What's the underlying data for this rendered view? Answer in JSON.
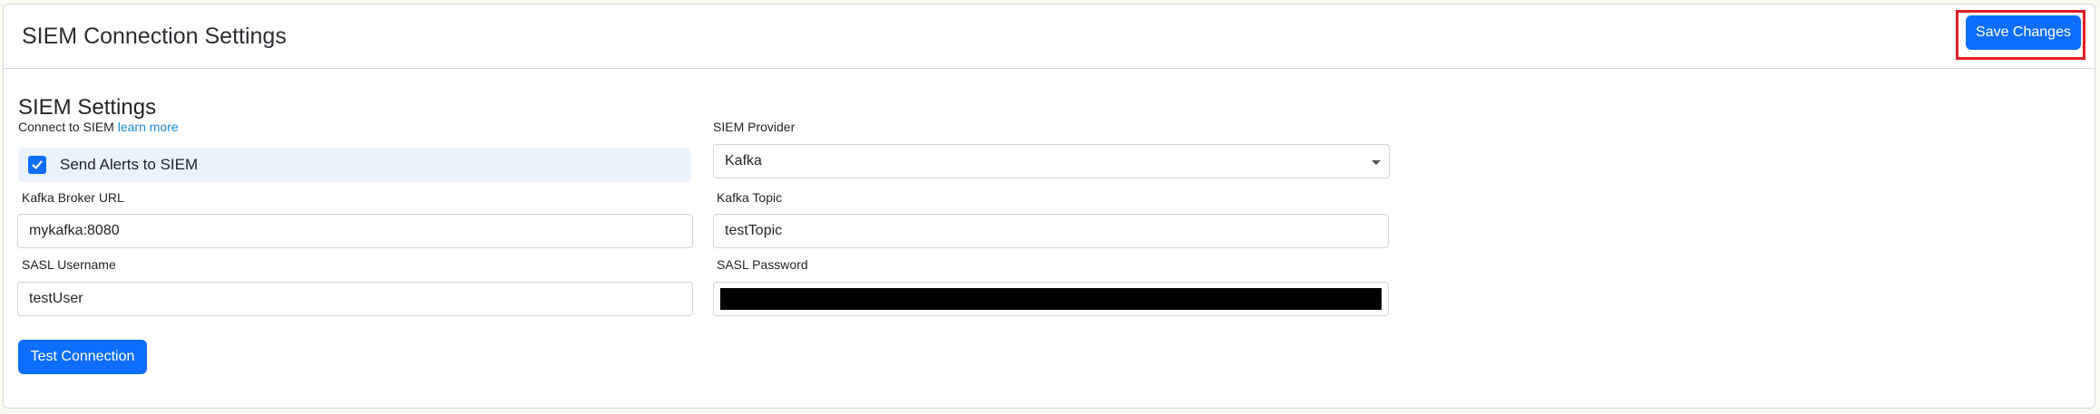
{
  "header": {
    "title": "SIEM Connection Settings",
    "save_label": "Save Changes"
  },
  "section": {
    "title": "SIEM Settings",
    "connect_text": "Connect to SIEM",
    "learn_more_link": "learn more"
  },
  "alerts_checkbox": {
    "label": "Send Alerts to SIEM",
    "checked": true
  },
  "provider": {
    "label": "SIEM Provider",
    "value": "Kafka"
  },
  "broker_url": {
    "label": "Kafka Broker URL",
    "value": "mykafka:8080"
  },
  "topic": {
    "label": "Kafka Topic",
    "value": "testTopic"
  },
  "username": {
    "label": "SASL Username",
    "value": "testUser"
  },
  "password": {
    "label": "SASL Password"
  },
  "test_button_label": "Test Connection",
  "colors": {
    "primary": "#0d6efd",
    "highlight": "#e01e26",
    "link": "#1a87d8",
    "checkbox_row_bg": "#eaf3fc"
  },
  "icons": {
    "checkbox": "checkmark-icon",
    "select": "caret-down-icon"
  }
}
